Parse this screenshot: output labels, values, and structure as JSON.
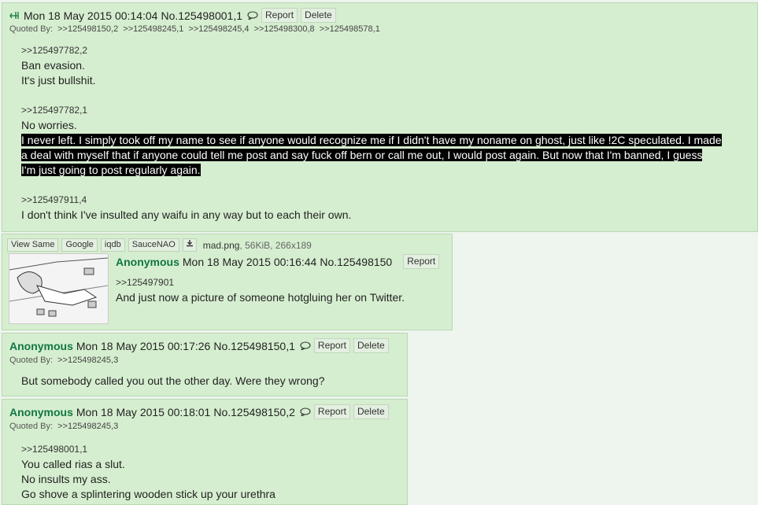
{
  "post1": {
    "datetime": "Mon 18 May 2015 00:14:04",
    "no": "No.125498001,1",
    "report": "Report",
    "delete": "Delete",
    "quoted_by_label": "Quoted By:",
    "quoted_by": [
      ">>125498150,2",
      ">>125498245,1",
      ">>125498245,4",
      ">>125498300,8",
      ">>125498578,1"
    ],
    "q1": ">>125497782,2",
    "q1_lines": [
      "Ban evasion.",
      "It's just bullshit."
    ],
    "q2": ">>125497782,1",
    "q2_line": "No worries.",
    "highlight_lines": [
      "I never left. I simply took off my name to see if anyone would recognize me if I didn't have my noname on ghost, just like !2C speculated. I made",
      "a deal with myself that if anyone could tell me post and say fuck off bern or call me out, I would post again. But now that I'm banned, I guess",
      "I'm just going to post regularly again."
    ],
    "q3": ">>125497911,4",
    "q3_line": "I don't think I've insulted any waifu in any way but to each their own."
  },
  "post2": {
    "toolbar": [
      "View Same",
      "Google",
      "iqdb",
      "SauceNAO"
    ],
    "filename": "mad.png",
    "filemeta": ", 56KiB, 266x189",
    "name": "Anonymous",
    "datetime": "Mon 18 May 2015 00:16:44",
    "no": "No.125498150",
    "report": "Report",
    "quote": ">>125497901",
    "line": "And just now a picture of someone hotgluing her on Twitter."
  },
  "post3": {
    "name": "Anonymous",
    "datetime": "Mon 18 May 2015 00:17:26",
    "no": "No.125498150,1",
    "report": "Report",
    "delete": "Delete",
    "quoted_by_label": "Quoted By:",
    "quoted_by": [
      ">>125498245,3"
    ],
    "line": "But somebody called you out the other day. Were they wrong?"
  },
  "post4": {
    "name": "Anonymous",
    "datetime": "Mon 18 May 2015 00:18:01",
    "no": "No.125498150,2",
    "report": "Report",
    "delete": "Delete",
    "quoted_by_label": "Quoted By:",
    "quoted_by": [
      ">>125498245,3"
    ],
    "quote": ">>125498001,1",
    "lines": [
      "You called rias a slut.",
      "No insults my ass.",
      "Go shove a splintering wooden stick up your urethra"
    ]
  },
  "icons": {
    "reply": "reply-arrow-icon",
    "chat": "speech-bubble-icon",
    "download": "download-icon"
  }
}
